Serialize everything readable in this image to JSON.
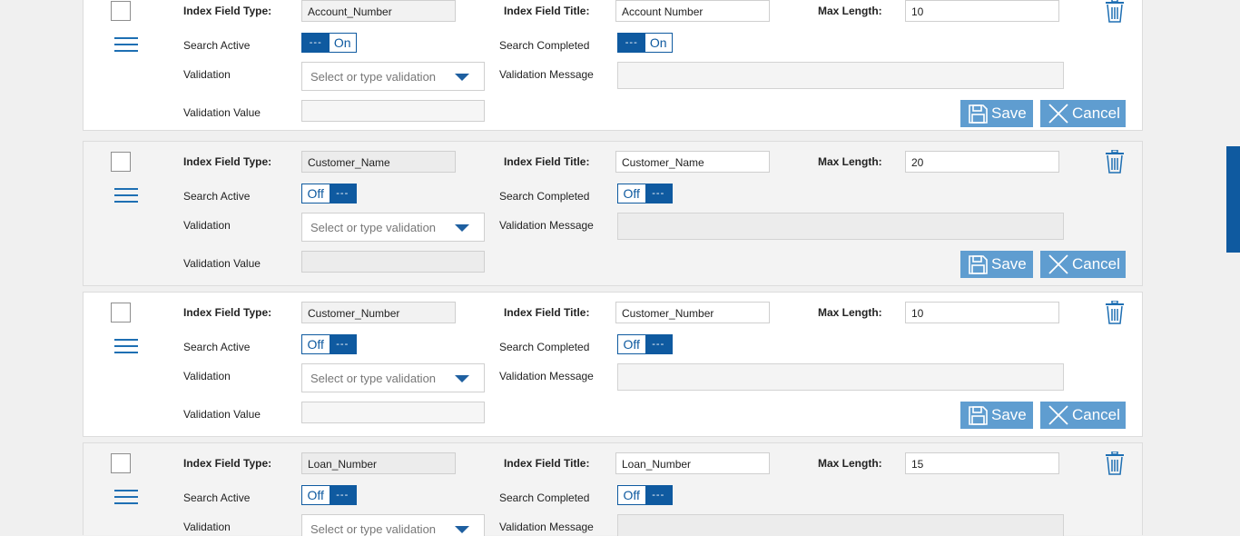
{
  "labels": {
    "field_type": "Index Field Type:",
    "field_title": "Index Field Title:",
    "max_length": "Max Length:",
    "search_active": "Search Active",
    "search_completed": "Search Completed",
    "validation": "Validation",
    "validation_message": "Validation Message",
    "validation_value": "Validation Value",
    "validation_placeholder": "Select or type validation",
    "save": "Save",
    "cancel": "Cancel",
    "toggle_dots": "---"
  },
  "colors": {
    "accent": "#0f5aa0",
    "button": "#5f9dd0",
    "icon_blue": "#1e6fb3"
  },
  "rows": [
    {
      "field_type": "Account_Number",
      "field_title": "Account Number",
      "max_length": "10",
      "search_active": "On",
      "search_completed": "On"
    },
    {
      "field_type": "Customer_Name",
      "field_title": "Customer_Name",
      "max_length": "20",
      "search_active": "Off",
      "search_completed": "Off"
    },
    {
      "field_type": "Customer_Number",
      "field_title": "Customer_Number",
      "max_length": "10",
      "search_active": "Off",
      "search_completed": "Off"
    },
    {
      "field_type": "Loan_Number",
      "field_title": "Loan_Number",
      "max_length": "15",
      "search_active": "Off",
      "search_completed": "Off"
    }
  ]
}
